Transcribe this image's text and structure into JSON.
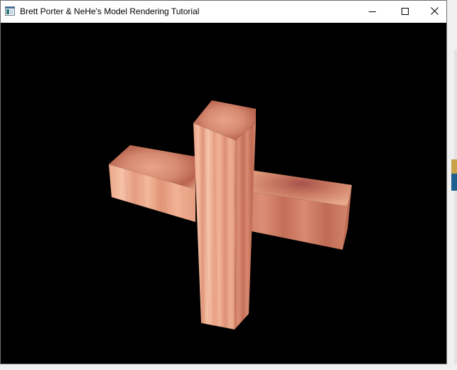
{
  "window": {
    "title": "Brett Porter & NeHe's Model Rendering Tutorial",
    "icons": {
      "app": "app-window-icon",
      "minimize": "minimize-icon",
      "maximize": "maximize-icon",
      "close": "close-icon"
    }
  },
  "scene": {
    "background_color": "#000000",
    "model": "cross",
    "texture_colors": [
      "#f0b49a",
      "#d98b73",
      "#b86454",
      "#8a3e36"
    ]
  }
}
